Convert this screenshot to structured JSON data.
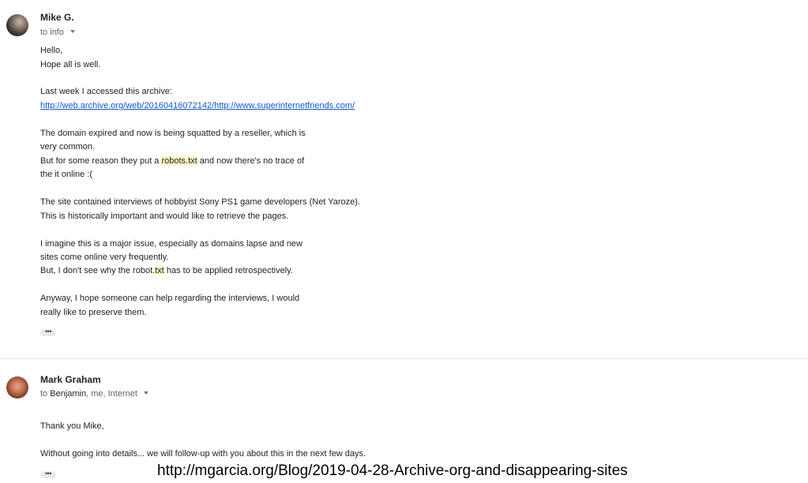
{
  "message1": {
    "sender": "Mike G.",
    "to_label": "to",
    "recipients": "info",
    "body": {
      "greeting": "Hello,",
      "line2": "Hope all is well.",
      "line3": "Last week I accessed this archive:",
      "link": "http://web.archive.org/web/20160416072142/http://www.superinternetfriends.com/",
      "p2_line1": "The domain expired and now is being squatted by a reseller, which is",
      "p2_line2": "very common.",
      "p2_line3_a": "But for some reason they put a ",
      "p2_line3_hl": "robots.txt",
      "p2_line3_b": " and now there's no trace of",
      "p2_line4": "the it online :(",
      "p3_line1": "The site contained interviews of hobbyist Sony PS1 game developers (Net Yaroze).",
      "p3_line2": "This is historically important and would like to retrieve the pages.",
      "p4_line1": "I imagine this is a major issue, especially as domains lapse and new",
      "p4_line2": "sites come online very frequently.",
      "p4_line3_a": "But, I don't see why the robot.",
      "p4_line3_hl": "txt",
      "p4_line3_b": " has to be applied retrospectively.",
      "p5_line1": "Anyway, I hope someone can help regarding the interviews, I would",
      "p5_line2": "really like to preserve them."
    },
    "ellipsis": "•••"
  },
  "message2": {
    "sender": "Mark Graham",
    "to_label": "to",
    "recipient1": "Benjamin",
    "recipient_rest": ", me, Internet",
    "body": {
      "line1": "Thank you Mike,",
      "line2": "Without going into details... we will follow-up with you about this in the next few days."
    },
    "ellipsis": "•••"
  },
  "caption": "http://mgarcia.org/Blog/2019-04-28-Archive-org-and-disappearing-sites",
  "colors": {
    "link": "#1155cc",
    "highlight": "#fcfbc5",
    "divider": "#ebebeb",
    "secondary_text": "#5f6368"
  }
}
